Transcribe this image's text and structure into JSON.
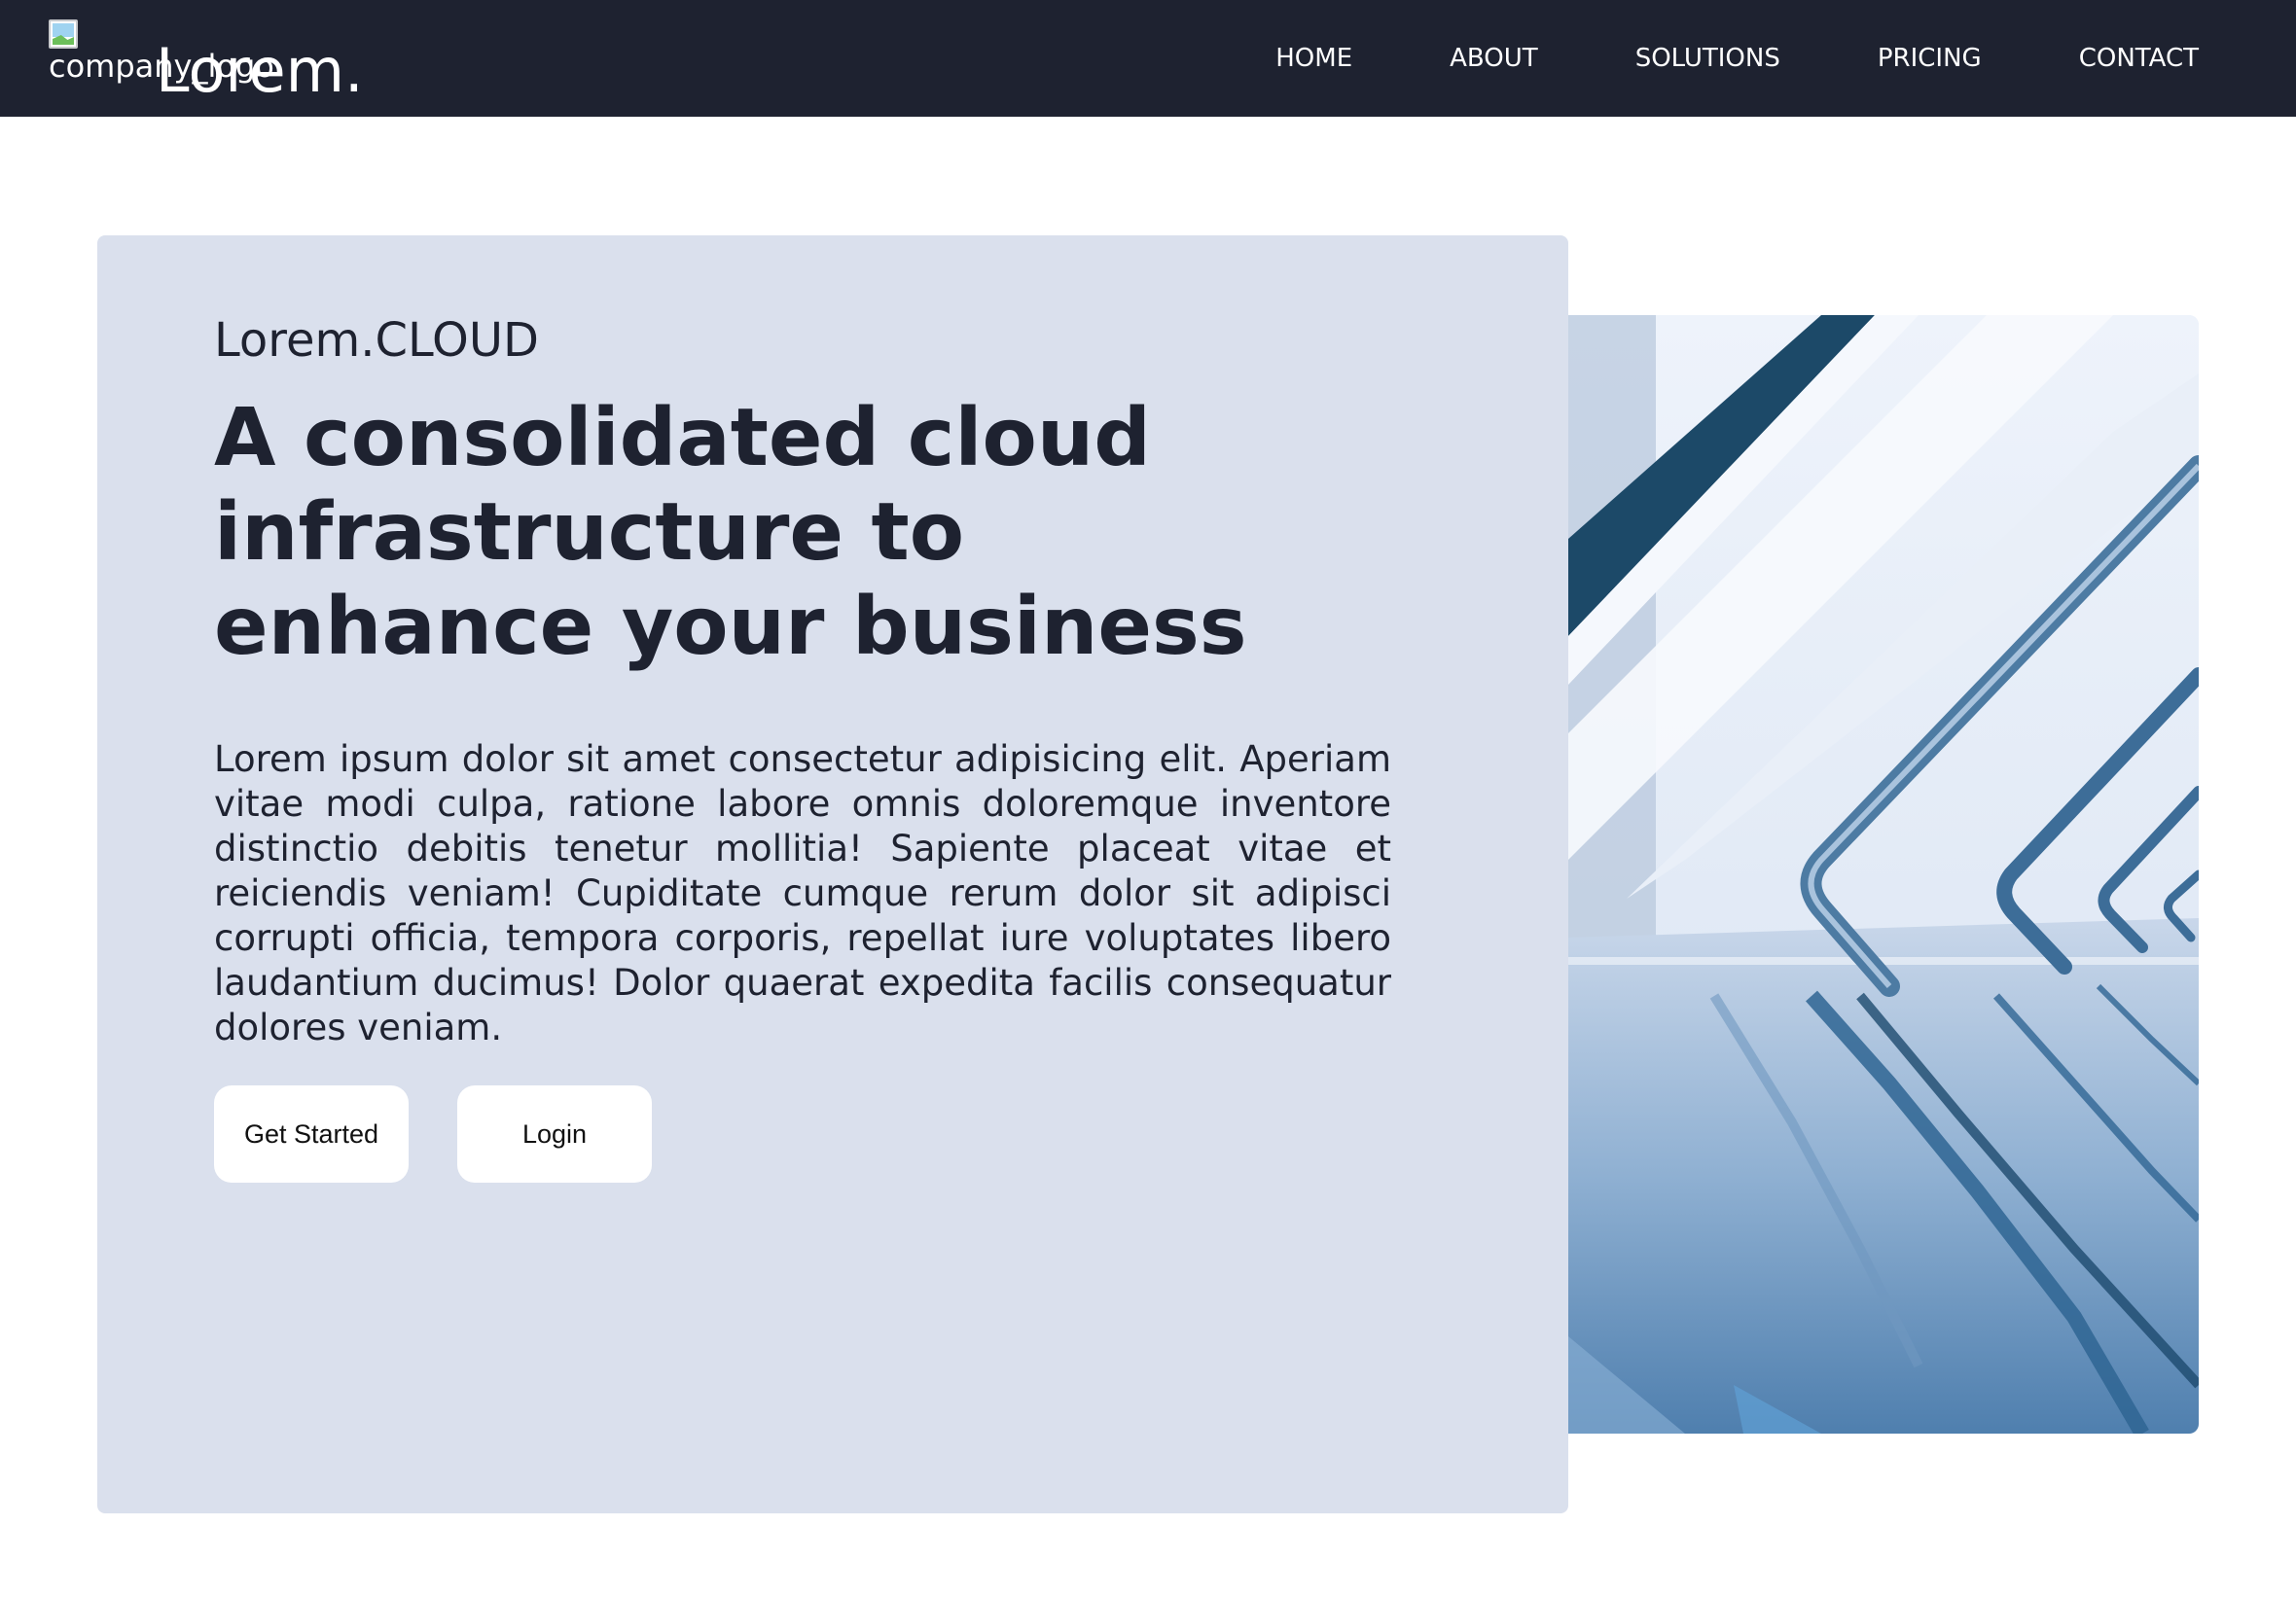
{
  "navbar": {
    "logo_alt": "company_logo",
    "brand": "Lorem.",
    "links": [
      "HOME",
      "ABOUT",
      "SOLUTIONS",
      "PRICING",
      "CONTACT"
    ]
  },
  "hero": {
    "eyebrow": "Lorem.CLOUD",
    "headline": "A consolidated cloud infrastructure to enhance your business",
    "body": "Lorem ipsum dolor sit amet consectetur adipisicing elit. Aperiam vitae modi culpa, ratione labore omnis doloremque inventore distinctio debitis tenetur mollitia! Sapiente placeat vitae et reiciendis veniam! Cupiditate cumque rerum dolor sit adipisci corrupti officia, tempora corporis, repellat iure voluptates libero laudantium ducimus! Dolor quaerat expedita facilis consequatur dolores veniam.",
    "buttons": {
      "get_started": "Get Started",
      "login": "Login"
    }
  },
  "colors": {
    "navbar_bg": "#1e2230",
    "hero_card_bg": "#dae0ed",
    "text_dark": "#1e2230",
    "image_accent": "#2f6593"
  }
}
